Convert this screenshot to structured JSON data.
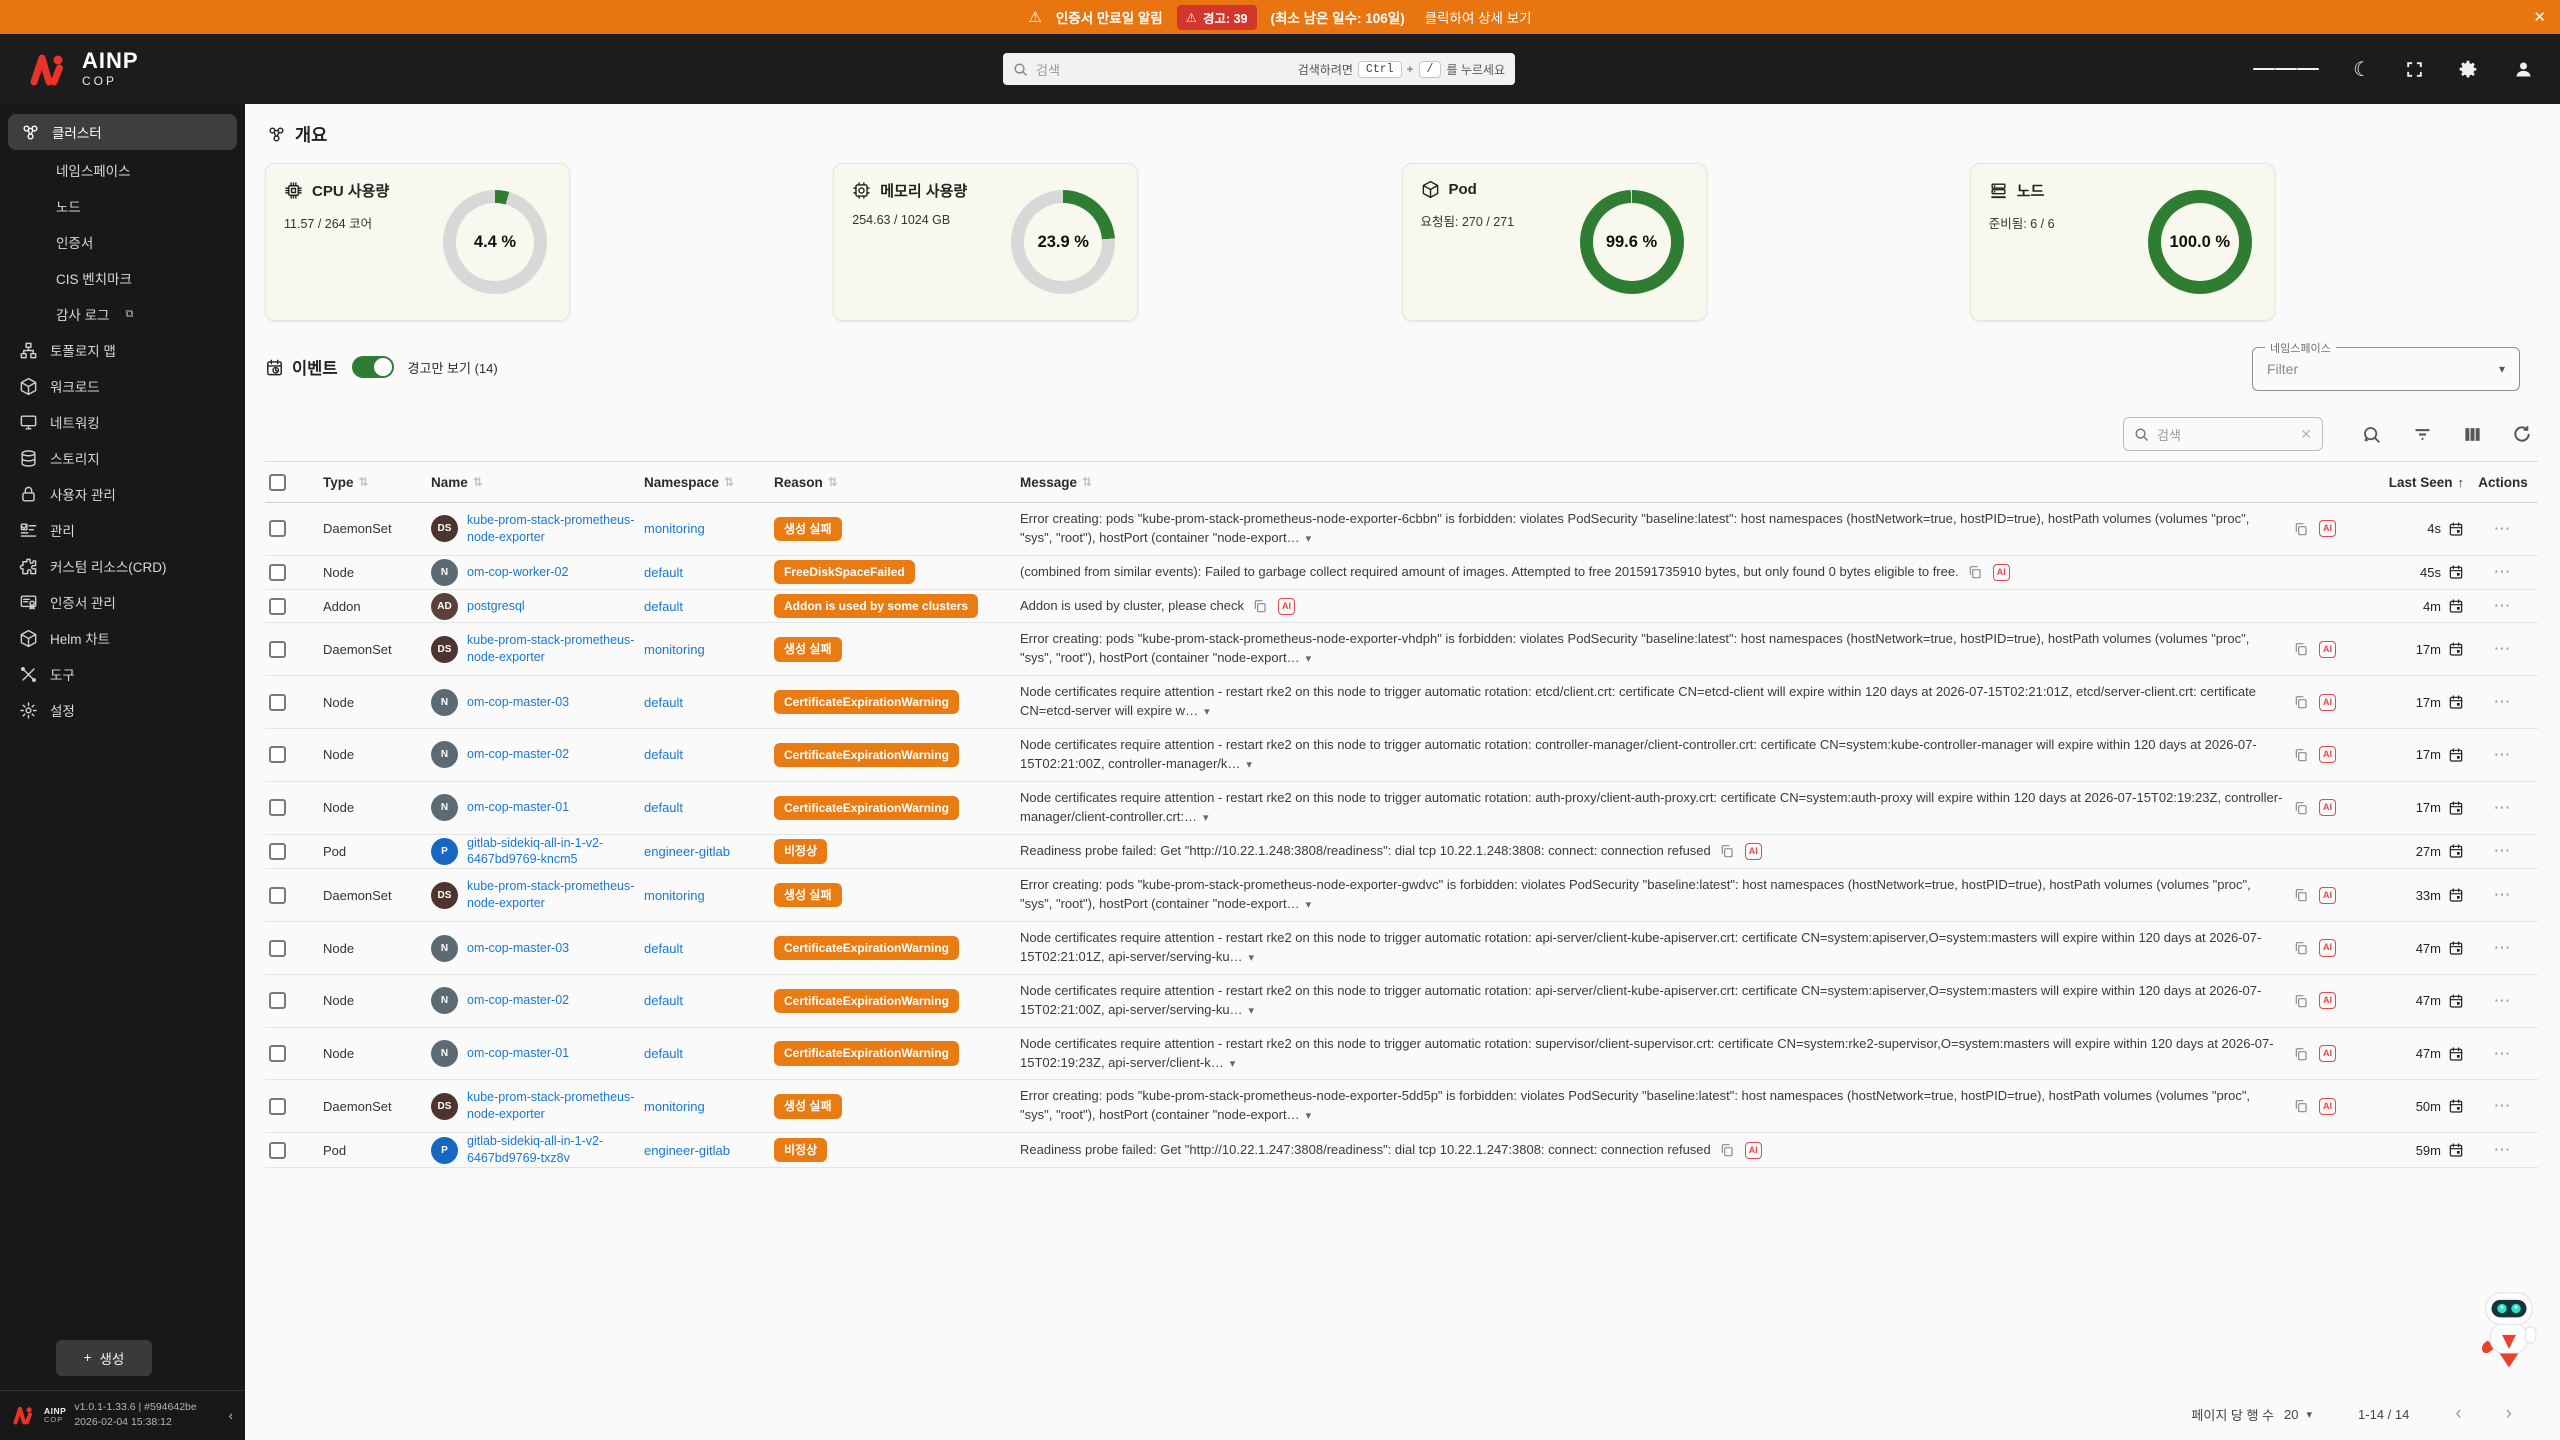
{
  "banner": {
    "title": "인증서 만료일 알림",
    "warning_badge": "경고: 39",
    "days_text": "(최소 남은 일수: 106일)",
    "detail_link": "클릭하여 상세 보기"
  },
  "header": {
    "logo_title": "AINP",
    "logo_subtitle": "COP",
    "search_placeholder": "검색",
    "search_hint_prefix": "검색하려면",
    "search_hint_key1": "Ctrl",
    "search_hint_plus": "+",
    "search_hint_key2": "/",
    "search_hint_suffix": "를 누르세요"
  },
  "icons": {
    "warning": "⚠",
    "close": "✕",
    "more": "⋯",
    "caret_down": "▾",
    "sort": "⇅",
    "sort_asc": "↑",
    "prev": "‹",
    "next": "›",
    "plus": "+",
    "ai": "AI",
    "collapse": "‹",
    "external": "⧉",
    "moon": "☾",
    "dropdown": "▾"
  },
  "sidebar": {
    "items": [
      {
        "label": "클러스터",
        "icon": "cluster",
        "active": true,
        "sub": false
      },
      {
        "label": "네임스페이스",
        "icon": "",
        "active": false,
        "sub": true
      },
      {
        "label": "노드",
        "icon": "",
        "active": false,
        "sub": true
      },
      {
        "label": "인증서",
        "icon": "",
        "active": false,
        "sub": true
      },
      {
        "label": "CIS 벤치마크",
        "icon": "",
        "active": false,
        "sub": true
      },
      {
        "label": "감사 로그",
        "icon": "",
        "active": false,
        "sub": true,
        "external": true
      },
      {
        "label": "토폴로지 맵",
        "icon": "topology",
        "active": false,
        "sub": false
      },
      {
        "label": "워크로드",
        "icon": "cube",
        "active": false,
        "sub": false
      },
      {
        "label": "네트워킹",
        "icon": "monitor",
        "active": false,
        "sub": false
      },
      {
        "label": "스토리지",
        "icon": "db",
        "active": false,
        "sub": false
      },
      {
        "label": "사용자 관리",
        "icon": "lock",
        "active": false,
        "sub": false
      },
      {
        "label": "관리",
        "icon": "checklist",
        "active": false,
        "sub": false
      },
      {
        "label": "커스텀 리소스(CRD)",
        "icon": "puzzle",
        "active": false,
        "sub": false
      },
      {
        "label": "인증서 관리",
        "icon": "cert",
        "active": false,
        "sub": false
      },
      {
        "label": "Helm 차트",
        "icon": "cube",
        "active": false,
        "sub": false
      },
      {
        "label": "도구",
        "icon": "tools",
        "active": false,
        "sub": false
      },
      {
        "label": "설정",
        "icon": "gear",
        "active": false,
        "sub": false
      }
    ],
    "create_button": "생성",
    "footer_version": "v1.0.1-1.33.6 | #594642be",
    "footer_date": "2026-02-04 15:38:12"
  },
  "overview": {
    "title": "개요",
    "cards": [
      {
        "title": "CPU 사용량",
        "icon": "chip",
        "subtitle": "11.57 / 264 코어",
        "percent": 4.4,
        "percent_label": "4.4 %"
      },
      {
        "title": "메모리 사용량",
        "icon": "mem",
        "subtitle": "254.63 / 1024 GB",
        "percent": 23.9,
        "percent_label": "23.9 %"
      },
      {
        "title": "Pod",
        "icon": "cube",
        "subtitle": "요청됨: 270 / 271",
        "percent": 99.6,
        "percent_label": "99.6 %"
      },
      {
        "title": "노드",
        "icon": "node",
        "subtitle": "준비됨: 6 / 6",
        "percent": 100,
        "percent_label": "100.0 %"
      }
    ],
    "donut_color": "#2e7d32",
    "donut_track": "#d8d8d8"
  },
  "events": {
    "title": "이벤트",
    "toggle_label": "경고만 보기 (14)",
    "namespace_filter_label": "네임스페이스",
    "namespace_filter_value": "Filter",
    "search_placeholder": "검색",
    "columns": {
      "type": "Type",
      "name": "Name",
      "namespace": "Namespace",
      "reason": "Reason",
      "message": "Message",
      "last_seen": "Last Seen",
      "actions": "Actions"
    },
    "avatar_colors": {
      "DS": "#4e342e",
      "N": "#5c6b73",
      "AD": "#5d4037",
      "P": "#1667c2"
    },
    "badge_color": "#e87c12",
    "rows": [
      {
        "type": "DaemonSet",
        "avatar": "DS",
        "name": "kube-prom-stack-prometheus-node-exporter",
        "namespace": "monitoring",
        "reason": "생성 실패",
        "message": "Error creating: pods \"kube-prom-stack-prometheus-node-exporter-6cbbn\" is forbidden: violates PodSecurity \"baseline:latest\": host namespaces (hostNetwork=true, hostPID=true), hostPath volumes (volumes \"proc\", \"sys\", \"root\"), hostPort (container \"node-export…",
        "truncated": true,
        "last_seen": "4s"
      },
      {
        "type": "Node",
        "avatar": "N",
        "name": "om-cop-worker-02",
        "namespace": "default",
        "reason": "FreeDiskSpaceFailed",
        "message": "(combined from similar events): Failed to garbage collect required amount of images. Attempted to free 201591735910 bytes, but only found 0 bytes eligible to free.",
        "truncated": false,
        "last_seen": "45s"
      },
      {
        "type": "Addon",
        "avatar": "AD",
        "name": "postgresql",
        "namespace": "default",
        "reason": "Addon is used by some clusters",
        "message": "Addon is used by cluster, please check",
        "truncated": false,
        "last_seen": "4m"
      },
      {
        "type": "DaemonSet",
        "avatar": "DS",
        "name": "kube-prom-stack-prometheus-node-exporter",
        "namespace": "monitoring",
        "reason": "생성 실패",
        "message": "Error creating: pods \"kube-prom-stack-prometheus-node-exporter-vhdph\" is forbidden: violates PodSecurity \"baseline:latest\": host namespaces (hostNetwork=true, hostPID=true), hostPath volumes (volumes \"proc\", \"sys\", \"root\"), hostPort (container \"node-export…",
        "truncated": true,
        "last_seen": "17m"
      },
      {
        "type": "Node",
        "avatar": "N",
        "name": "om-cop-master-03",
        "namespace": "default",
        "reason": "CertificateExpirationWarning",
        "message": "Node certificates require attention - restart rke2 on this node to trigger automatic rotation: etcd/client.crt: certificate CN=etcd-client will expire within 120 days at 2026-07-15T02:21:01Z, etcd/server-client.crt: certificate CN=etcd-server will expire w…",
        "truncated": true,
        "last_seen": "17m"
      },
      {
        "type": "Node",
        "avatar": "N",
        "name": "om-cop-master-02",
        "namespace": "default",
        "reason": "CertificateExpirationWarning",
        "message": "Node certificates require attention - restart rke2 on this node to trigger automatic rotation: controller-manager/client-controller.crt: certificate CN=system:kube-controller-manager will expire within 120 days at 2026-07-15T02:21:00Z, controller-manager/k…",
        "truncated": true,
        "last_seen": "17m"
      },
      {
        "type": "Node",
        "avatar": "N",
        "name": "om-cop-master-01",
        "namespace": "default",
        "reason": "CertificateExpirationWarning",
        "message": "Node certificates require attention - restart rke2 on this node to trigger automatic rotation: auth-proxy/client-auth-proxy.crt: certificate CN=system:auth-proxy will expire within 120 days at 2026-07-15T02:19:23Z, controller-manager/client-controller.crt:…",
        "truncated": true,
        "last_seen": "17m"
      },
      {
        "type": "Pod",
        "avatar": "P",
        "name": "gitlab-sidekiq-all-in-1-v2-6467bd9769-kncm5",
        "namespace": "engineer-gitlab",
        "reason": "비정상",
        "message": "Readiness probe failed: Get \"http://10.22.1.248:3808/readiness\": dial tcp 10.22.1.248:3808: connect: connection refused",
        "truncated": false,
        "last_seen": "27m"
      },
      {
        "type": "DaemonSet",
        "avatar": "DS",
        "name": "kube-prom-stack-prometheus-node-exporter",
        "namespace": "monitoring",
        "reason": "생성 실패",
        "message": "Error creating: pods \"kube-prom-stack-prometheus-node-exporter-gwdvc\" is forbidden: violates PodSecurity \"baseline:latest\": host namespaces (hostNetwork=true, hostPID=true), hostPath volumes (volumes \"proc\", \"sys\", \"root\"), hostPort (container \"node-export…",
        "truncated": true,
        "last_seen": "33m"
      },
      {
        "type": "Node",
        "avatar": "N",
        "name": "om-cop-master-03",
        "namespace": "default",
        "reason": "CertificateExpirationWarning",
        "message": "Node certificates require attention - restart rke2 on this node to trigger automatic rotation: api-server/client-kube-apiserver.crt: certificate CN=system:apiserver,O=system:masters will expire within 120 days at 2026-07-15T02:21:01Z, api-server/serving-ku…",
        "truncated": true,
        "last_seen": "47m"
      },
      {
        "type": "Node",
        "avatar": "N",
        "name": "om-cop-master-02",
        "namespace": "default",
        "reason": "CertificateExpirationWarning",
        "message": "Node certificates require attention - restart rke2 on this node to trigger automatic rotation: api-server/client-kube-apiserver.crt: certificate CN=system:apiserver,O=system:masters will expire within 120 days at 2026-07-15T02:21:00Z, api-server/serving-ku…",
        "truncated": true,
        "last_seen": "47m"
      },
      {
        "type": "Node",
        "avatar": "N",
        "name": "om-cop-master-01",
        "namespace": "default",
        "reason": "CertificateExpirationWarning",
        "message": "Node certificates require attention - restart rke2 on this node to trigger automatic rotation: supervisor/client-supervisor.crt: certificate CN=system:rke2-supervisor,O=system:masters will expire within 120 days at 2026-07-15T02:19:23Z, api-server/client-k…",
        "truncated": true,
        "last_seen": "47m"
      },
      {
        "type": "DaemonSet",
        "avatar": "DS",
        "name": "kube-prom-stack-prometheus-node-exporter",
        "namespace": "monitoring",
        "reason": "생성 실패",
        "message": "Error creating: pods \"kube-prom-stack-prometheus-node-exporter-5dd5p\" is forbidden: violates PodSecurity \"baseline:latest\": host namespaces (hostNetwork=true, hostPID=true), hostPath volumes (volumes \"proc\", \"sys\", \"root\"), hostPort (container \"node-export…",
        "truncated": true,
        "last_seen": "50m"
      },
      {
        "type": "Pod",
        "avatar": "P",
        "name": "gitlab-sidekiq-all-in-1-v2-6467bd9769-txz8v",
        "namespace": "engineer-gitlab",
        "reason": "비정상",
        "message": "Readiness probe failed: Get \"http://10.22.1.247:3808/readiness\": dial tcp 10.22.1.247:3808: connect: connection refused",
        "truncated": false,
        "last_seen": "59m"
      }
    ]
  },
  "pagination": {
    "rows_per_page_label": "페이지 당 행 수",
    "rows_per_page_value": "20",
    "range": "1-14 / 14"
  }
}
